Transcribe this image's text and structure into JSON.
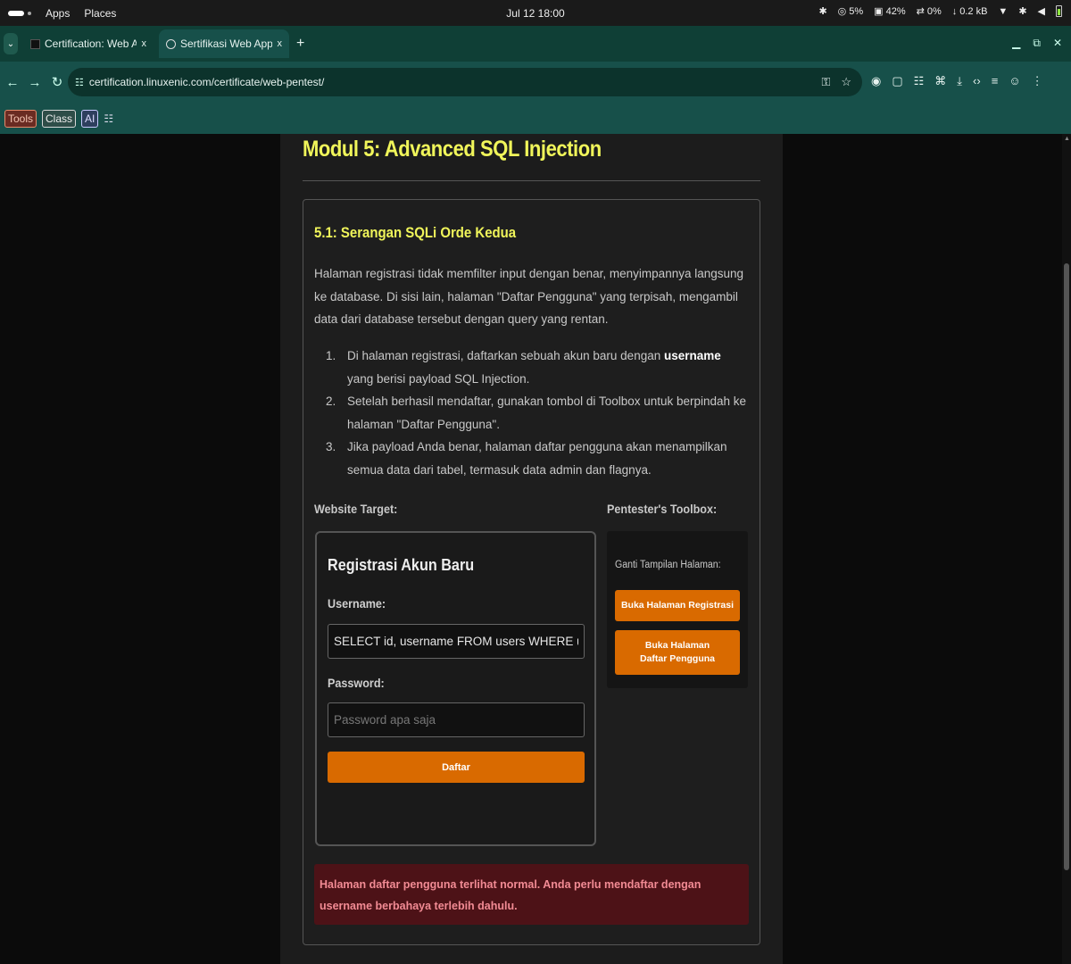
{
  "os_bar": {
    "apps_label": "Apps",
    "places_label": "Places",
    "clock": "Jul 12  18:00",
    "cpu": "5%",
    "memory": "42%",
    "swap": "0%",
    "network": "0.2 kB"
  },
  "browser": {
    "tabs": [
      {
        "title": "Certification: Web Applic",
        "close": "x",
        "active": false
      },
      {
        "title": "Sertifikasi Web Applicati",
        "close": "x",
        "active": true
      }
    ],
    "new_tab": "+",
    "url": "certification.linuxenic.com/certificate/web-pentest/",
    "bookmarks": [
      "Tools",
      "Class",
      "AI"
    ]
  },
  "page": {
    "module_title": "Modul 5: Advanced SQL Injection",
    "section_title": "5.1: Serangan SQLi Orde Kedua",
    "intro": "Halaman registrasi tidak memfilter input dengan benar, menyimpannya langsung ke database. Di sisi lain, halaman \"Daftar Pengguna\" yang terpisah, mengambil data dari database tersebut dengan query yang rentan.",
    "steps": [
      {
        "num": "1.",
        "pre": "Di halaman registrasi, daftarkan sebuah akun baru dengan ",
        "bold": "username",
        "post": " yang berisi payload SQL Injection."
      },
      {
        "num": "2.",
        "pre": "Setelah berhasil mendaftar, gunakan tombol di Toolbox untuk berpindah ke halaman \"Daftar Pengguna\".",
        "bold": "",
        "post": ""
      },
      {
        "num": "3.",
        "pre": "Jika payload Anda benar, halaman daftar pengguna akan menampilkan semua data dari tabel, termasuk data admin dan flagnya.",
        "bold": "",
        "post": ""
      }
    ],
    "target_label": "Website Target:",
    "toolbox_label": "Pentester's Toolbox:",
    "register_form": {
      "title": "Registrasi Akun Baru",
      "username_label": "Username:",
      "username_value": "SELECT id, username FROM users WHERE username = '$user'",
      "password_label": "Password:",
      "password_placeholder": "Password apa saja",
      "submit_label": "Daftar"
    },
    "toolbox": {
      "view_label": "Ganti Tampilan Halaman:",
      "btn_register": "Buka Halaman Registrasi",
      "btn_users": "Buka Halaman Daftar Pengguna"
    },
    "alert": "Halaman daftar pengguna terlihat normal. Anda perlu mendaftar dengan username berbahaya terlebih dahulu."
  },
  "colors": {
    "accent_yellow": "#f0f55a",
    "button_orange": "#d96a00",
    "alert_bg": "#4d1217",
    "alert_text": "#f28b94",
    "browser_green": "#17504a"
  }
}
